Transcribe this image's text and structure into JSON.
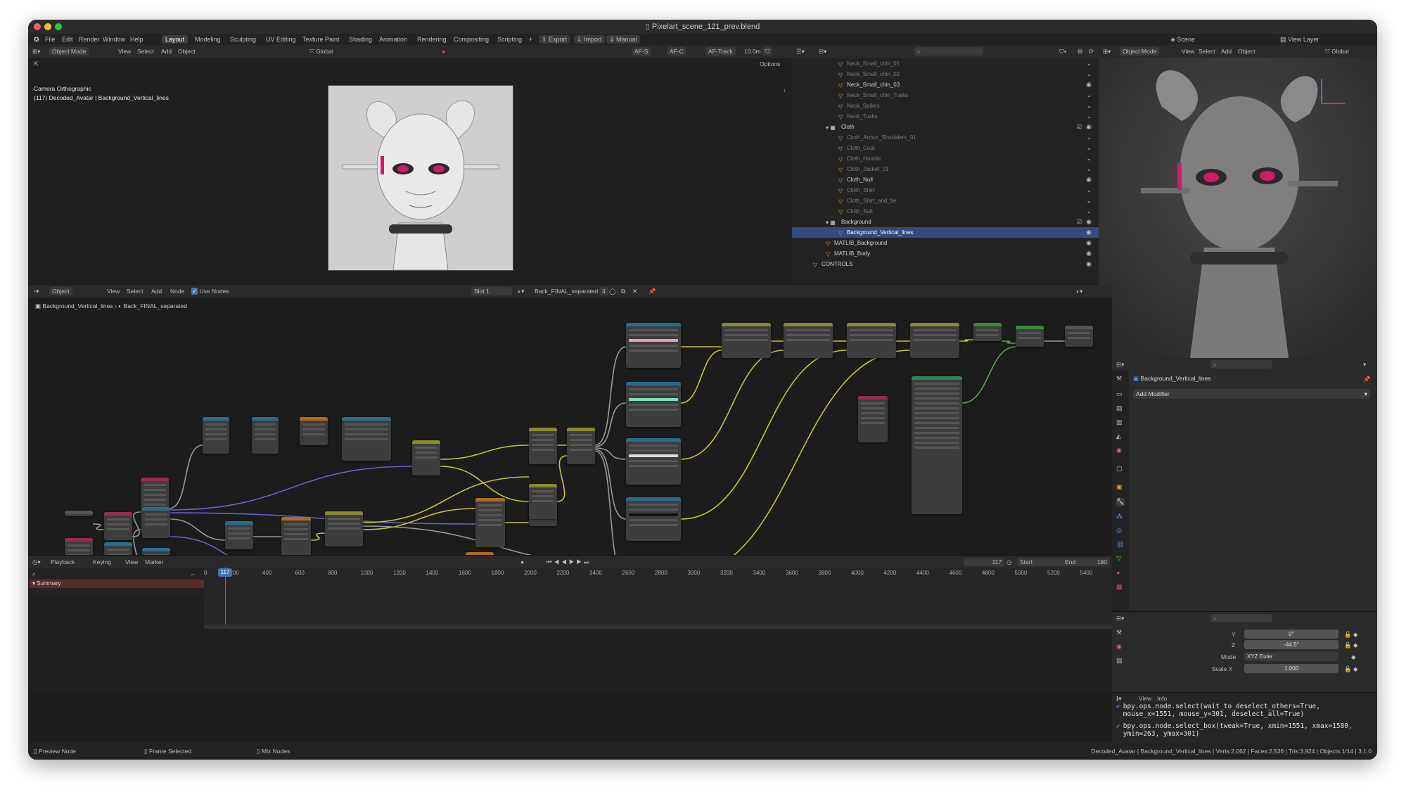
{
  "window": {
    "title": "Pixelart_scene_121_prev.blend"
  },
  "menu": [
    "File",
    "Edit",
    "Render",
    "Window",
    "Help"
  ],
  "workspaces": [
    {
      "label": "Layout",
      "active": true
    },
    {
      "label": "Modeling"
    },
    {
      "label": "Sculpting"
    },
    {
      "label": "UV Editing"
    },
    {
      "label": "Texture Paint"
    },
    {
      "label": "Shading"
    },
    {
      "label": "Animation"
    },
    {
      "label": "Rendering"
    },
    {
      "label": "Compositing"
    },
    {
      "label": "Scripting"
    }
  ],
  "addons": {
    "export": "Export",
    "import": "Import",
    "manual": "Manual"
  },
  "scene": {
    "label": "Scene",
    "view_layer": "View Layer"
  },
  "viewport": {
    "mode": "Object Mode",
    "menus": [
      "View",
      "Select",
      "Add",
      "Object"
    ],
    "orientation": "Global",
    "af_s": "AF-S",
    "af_c": "AF-C",
    "af_track": "AF-Track",
    "focal": "10.0m",
    "options": "Options",
    "overlay_line1": "Camera Orthographic",
    "overlay_line2": "(117) Decoded_Avatar | Background_Vertical_lines"
  },
  "outliner": {
    "rows": [
      {
        "label": "Neck_Small_chin_01",
        "indent": 3,
        "vis": false
      },
      {
        "label": "Neck_Small_chin_02",
        "indent": 3,
        "vis": false
      },
      {
        "label": "Neck_Small_chin_03",
        "indent": 3,
        "vis": true
      },
      {
        "label": "Neck_Small_chin_Tusks",
        "indent": 3,
        "vis": false
      },
      {
        "label": "Neck_Spikes",
        "indent": 3,
        "vis": false
      },
      {
        "label": "Neck_Tusks",
        "indent": 3,
        "vis": false
      },
      {
        "label": "Cloth",
        "indent": 2,
        "vis": true,
        "collection": true
      },
      {
        "label": "Cloth_Armor_Shoulders_01",
        "indent": 3,
        "vis": false
      },
      {
        "label": "Cloth_Coat",
        "indent": 3,
        "vis": false
      },
      {
        "label": "Cloth_Hoodie",
        "indent": 3,
        "vis": false
      },
      {
        "label": "Cloth_Jacket_01",
        "indent": 3,
        "vis": false
      },
      {
        "label": "Cloth_Null",
        "indent": 3,
        "vis": true
      },
      {
        "label": "Cloth_Shirt",
        "indent": 3,
        "vis": false
      },
      {
        "label": "Cloth_Shirt_and_tie",
        "indent": 3,
        "vis": false
      },
      {
        "label": "Cloth_Suit",
        "indent": 3,
        "vis": false
      },
      {
        "label": "Background",
        "indent": 2,
        "vis": true,
        "collection": true
      },
      {
        "label": "Background_Vertical_lines",
        "indent": 3,
        "vis": true,
        "selected": true
      },
      {
        "label": "MATLIB_Background",
        "indent": 2,
        "vis": true
      },
      {
        "label": "MATLIB_Body",
        "indent": 2,
        "vis": true
      },
      {
        "label": "CONTROLS",
        "indent": 1,
        "vis": true
      }
    ]
  },
  "right_viewport": {
    "mode": "Object Mode",
    "menus": [
      "View",
      "Select",
      "Add",
      "Object"
    ],
    "orientation": "Global"
  },
  "node_editor": {
    "type": "Object",
    "menus": [
      "View",
      "Select",
      "Add",
      "Node"
    ],
    "use_nodes": "Use Nodes",
    "slot": "Slot 1",
    "material": "Back_FINAL_separated",
    "users": "4",
    "breadcrumb_object": "Background_Vertical_lines",
    "breadcrumb_material": "Back_FINAL_separated"
  },
  "properties": {
    "object_name": "Background_Vertical_lines",
    "add_modifier": "Add Modifier",
    "fields": [
      {
        "label": "Y",
        "value": "0°"
      },
      {
        "label": "Z",
        "value": "-44.5°"
      },
      {
        "label": "Mode",
        "value": "XYZ Euler"
      },
      {
        "label": "Scale X",
        "value": "1.000"
      }
    ]
  },
  "timeline": {
    "menus": [
      "Playback",
      "Keying",
      "View",
      "Marker"
    ],
    "current_frame": "117",
    "start_label": "Start",
    "start": "1",
    "end_label": "End",
    "end": "180",
    "ticks": [
      "0",
      "200",
      "400",
      "600",
      "800",
      "1000",
      "1200",
      "1400",
      "1600",
      "1800",
      "2000",
      "2200",
      "2400",
      "2600",
      "2800",
      "3000",
      "3200",
      "3400",
      "3600",
      "3800",
      "4000",
      "4200",
      "4400",
      "4600",
      "4800",
      "5000",
      "5200",
      "5400"
    ],
    "summary": "Summary"
  },
  "info": {
    "menus": [
      "View",
      "Info"
    ],
    "lines": [
      "bpy.ops.node.select(wait_to_deselect_others=True, mouse_x=1551, mouse_y=301, deselect_all=True)",
      "bpy.ops.node.select_box(tweak=True, xmin=1551, xmax=1580, ymin=263, ymax=301)"
    ]
  },
  "statusbar": {
    "items": [
      "Preview Node",
      "Frame Selected",
      "Mix Nodes"
    ],
    "stats": "Decoded_Avatar | Background_Vertical_lines | Verts:2,062 | Faces:2,536 | Tris:3,924 | Objects:1/14 | 3.1.0"
  },
  "colors": {
    "accent": "#4772b3",
    "selected_row": "#334b7e",
    "playhead": "#4772b3",
    "node_bg": "#3d3d3d",
    "wire_yellow": "#c8c23a",
    "wire_purple": "#6a63c8",
    "wire_gray": "#9a9a9a",
    "wire_green": "#5aa64a"
  }
}
